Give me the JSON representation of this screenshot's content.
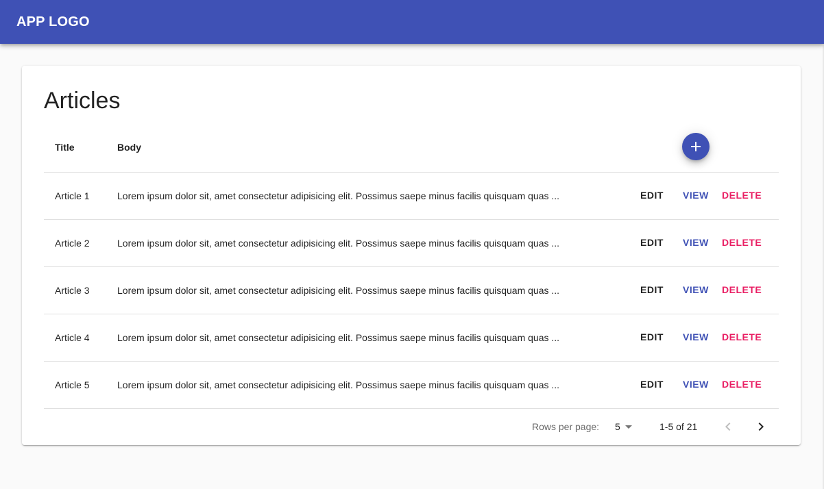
{
  "appbar": {
    "logo": "APP LOGO",
    "color": "#3f51b5"
  },
  "page": {
    "title": "Articles"
  },
  "table": {
    "columns": [
      "Title",
      "Body"
    ],
    "add_icon": "plus-icon",
    "rows": [
      {
        "title": "Article 1",
        "body": "Lorem ipsum dolor sit, amet consectetur adipisicing elit. Possimus saepe minus facilis quisquam quas ..."
      },
      {
        "title": "Article 2",
        "body": "Lorem ipsum dolor sit, amet consectetur adipisicing elit. Possimus saepe minus facilis quisquam quas ..."
      },
      {
        "title": "Article 3",
        "body": "Lorem ipsum dolor sit, amet consectetur adipisicing elit. Possimus saepe minus facilis quisquam quas ..."
      },
      {
        "title": "Article 4",
        "body": "Lorem ipsum dolor sit, amet consectetur adipisicing elit. Possimus saepe minus facilis quisquam quas ..."
      },
      {
        "title": "Article 5",
        "body": "Lorem ipsum dolor sit, amet consectetur adipisicing elit. Possimus saepe minus facilis quisquam quas ..."
      }
    ],
    "actions": {
      "edit": "EDIT",
      "view": "VIEW",
      "delete": "DELETE"
    },
    "colors": {
      "view": "#3f51b5",
      "delete": "#e91e63"
    }
  },
  "pagination": {
    "rows_per_page_label": "Rows per page:",
    "rows_per_page_value": "5",
    "range": "1-5 of 21",
    "prev_icon": "chevron-left-icon",
    "next_icon": "chevron-right-icon"
  }
}
